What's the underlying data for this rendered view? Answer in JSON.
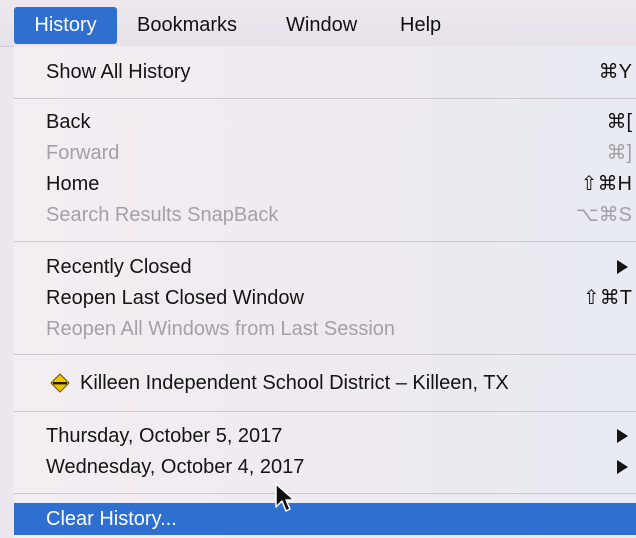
{
  "menubar": {
    "items": [
      {
        "label": "History"
      },
      {
        "label": "Bookmarks"
      },
      {
        "label": "Window"
      },
      {
        "label": "Help"
      }
    ]
  },
  "menu": {
    "show_all_history": {
      "label": "Show All History",
      "shortcut": "⌘Y"
    },
    "back": {
      "label": "Back",
      "shortcut": "⌘["
    },
    "forward": {
      "label": "Forward",
      "shortcut": "⌘]"
    },
    "home": {
      "label": "Home",
      "shortcut": "⇧⌘H"
    },
    "search_results_snapback": {
      "label": "Search Results SnapBack",
      "shortcut": "⌥⌘S"
    },
    "recently_closed": {
      "label": "Recently Closed"
    },
    "reopen_last_closed_window": {
      "label": "Reopen Last Closed Window",
      "shortcut": "⇧⌘T"
    },
    "reopen_all_windows": {
      "label": "Reopen All Windows from Last Session"
    },
    "history_site": {
      "label": "Killeen Independent School District – Killeen, TX",
      "icon": "school-district-icon"
    },
    "day1": {
      "label": "Thursday, October 5, 2017"
    },
    "day2": {
      "label": "Wednesday, October 4, 2017"
    },
    "clear_history": {
      "label": "Clear History..."
    }
  },
  "colors": {
    "selection": "#2f6fd0",
    "disabled_text": "#a3a0a6"
  }
}
